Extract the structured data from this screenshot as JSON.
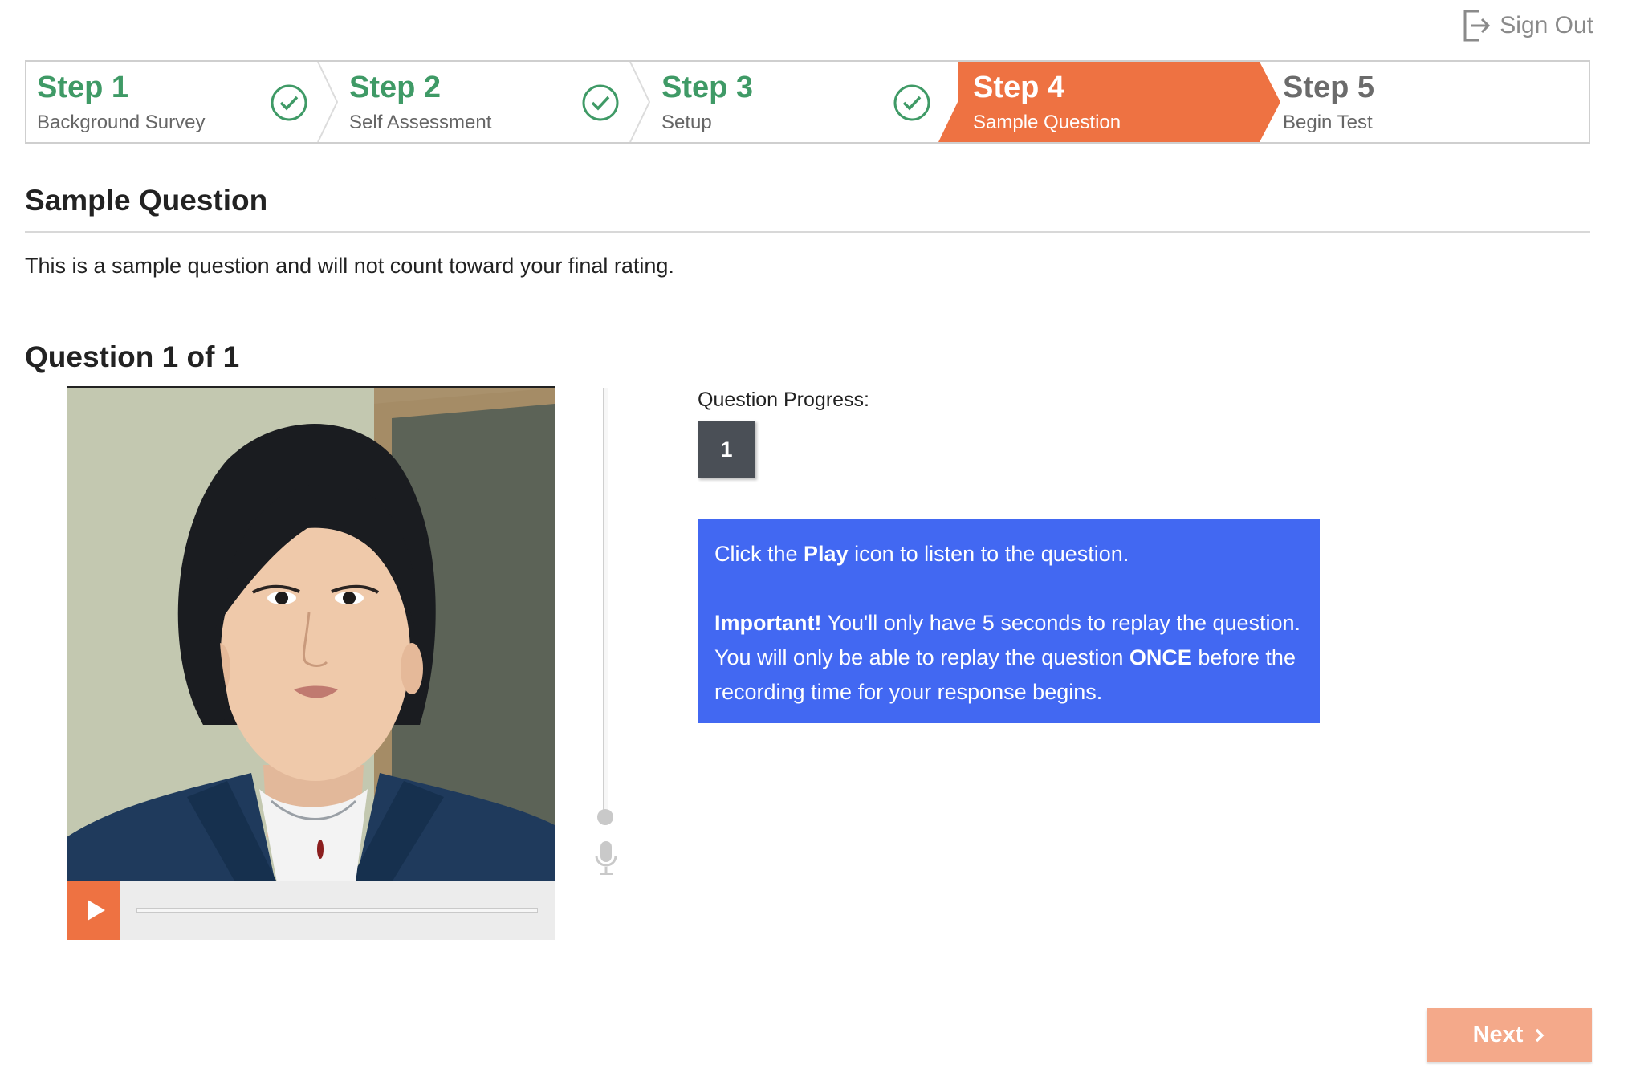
{
  "header": {
    "sign_out_label": "Sign Out"
  },
  "stepper": {
    "steps": [
      {
        "number": "Step 1",
        "label": "Background Survey",
        "state": "done"
      },
      {
        "number": "Step 2",
        "label": "Self Assessment",
        "state": "done"
      },
      {
        "number": "Step 3",
        "label": "Setup",
        "state": "done"
      },
      {
        "number": "Step 4",
        "label": "Sample Question",
        "state": "current"
      },
      {
        "number": "Step 5",
        "label": "Begin Test",
        "state": "upcoming"
      }
    ]
  },
  "section": {
    "title": "Sample Question",
    "intro": "This is a sample question and will not count toward your final rating."
  },
  "question": {
    "title": "Question 1 of 1",
    "progress_label": "Question Progress:",
    "progress_items": [
      "1"
    ]
  },
  "info": {
    "line1_pre": "Click the ",
    "line1_bold": "Play",
    "line1_post": " icon to listen to the question.",
    "important_bold": "Important!",
    "important_text": " You'll only have 5 seconds to replay the question. You will only be able to replay the question ",
    "once_bold": "ONCE",
    "once_post": " before the recording time for your response begins."
  },
  "footer": {
    "next_label": "Next"
  },
  "colors": {
    "accent": "#ee7242",
    "done_green": "#3f9a66",
    "info_blue": "#4268f2",
    "next_disabled": "#f4a98a",
    "progress_box": "#4a4f56"
  },
  "icons": {
    "sign_out": "sign-out-icon",
    "check": "check-circle-icon",
    "play": "play-icon",
    "mic": "microphone-icon",
    "next": "chevron-right-icon"
  }
}
